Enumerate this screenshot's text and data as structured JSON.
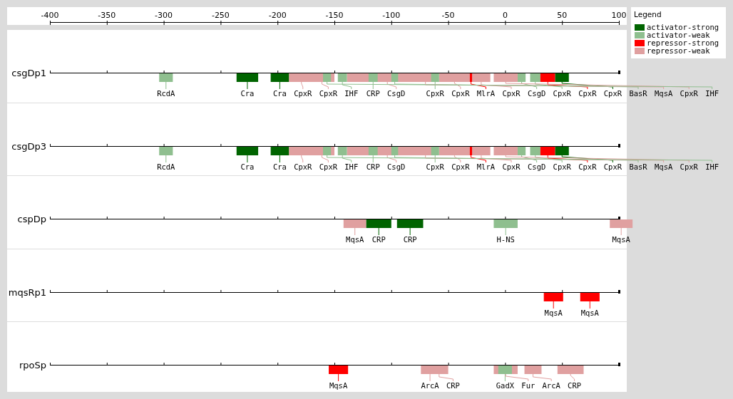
{
  "axis": {
    "ticks": [
      "-400",
      "-350",
      "-300",
      "-250",
      "-200",
      "-150",
      "-100",
      "-50",
      "0",
      "50",
      "100"
    ]
  },
  "tracks": [
    {
      "name": "csgDp1",
      "sites": [
        {
          "label": "RcdA",
          "kind": "activator-weak"
        },
        {
          "label": "Cra",
          "kind": "activator-strong"
        },
        {
          "label": "Cra",
          "kind": "activator-strong"
        },
        {
          "label": "CpxR",
          "kind": "repressor-weak"
        },
        {
          "label": "CpxR",
          "kind": "repressor-weak"
        },
        {
          "label": "IHF",
          "kind": "activator-weak"
        },
        {
          "label": "CRP",
          "kind": "activator-weak"
        },
        {
          "label": "CsgD",
          "kind": "repressor-weak"
        },
        {
          "label": "CpxR",
          "kind": "activator-weak"
        },
        {
          "label": "CpxR",
          "kind": "repressor-weak"
        },
        {
          "label": "MlrA",
          "kind": "repressor-strong"
        },
        {
          "label": "CpxR",
          "kind": "repressor-weak"
        },
        {
          "label": "CsgD",
          "kind": "activator-weak"
        },
        {
          "label": "CpxR",
          "kind": "activator-weak"
        },
        {
          "label": "CpxR",
          "kind": "repressor-strong"
        },
        {
          "label": "CpxR",
          "kind": "activator-strong"
        },
        {
          "label": "BasR",
          "kind": "activator-weak"
        },
        {
          "label": "MqsA",
          "kind": "repressor-weak"
        },
        {
          "label": "CpxR",
          "kind": "repressor-weak"
        },
        {
          "label": "IHF",
          "kind": "activator-weak"
        }
      ]
    },
    {
      "name": "csgDp3",
      "sites": [
        {
          "label": "RcdA",
          "kind": "activator-weak"
        },
        {
          "label": "Cra",
          "kind": "activator-strong"
        },
        {
          "label": "Cra",
          "kind": "activator-strong"
        },
        {
          "label": "CpxR",
          "kind": "repressor-weak"
        },
        {
          "label": "CpxR",
          "kind": "repressor-weak"
        },
        {
          "label": "IHF",
          "kind": "activator-weak"
        },
        {
          "label": "CRP",
          "kind": "activator-weak"
        },
        {
          "label": "CsgD",
          "kind": "repressor-weak"
        },
        {
          "label": "CpxR",
          "kind": "activator-weak"
        },
        {
          "label": "CpxR",
          "kind": "repressor-weak"
        },
        {
          "label": "MlrA",
          "kind": "repressor-strong"
        },
        {
          "label": "CpxR",
          "kind": "repressor-weak"
        },
        {
          "label": "CsgD",
          "kind": "activator-weak"
        },
        {
          "label": "CpxR",
          "kind": "activator-weak"
        },
        {
          "label": "CpxR",
          "kind": "repressor-strong"
        },
        {
          "label": "CpxR",
          "kind": "activator-strong"
        },
        {
          "label": "BasR",
          "kind": "activator-weak"
        },
        {
          "label": "MqsA",
          "kind": "repressor-weak"
        },
        {
          "label": "CpxR",
          "kind": "repressor-weak"
        },
        {
          "label": "IHF",
          "kind": "activator-weak"
        }
      ]
    },
    {
      "name": "cspDp",
      "sites": [
        {
          "label": "MqsA",
          "kind": "repressor-weak"
        },
        {
          "label": "CRP",
          "kind": "activator-strong"
        },
        {
          "label": "CRP",
          "kind": "activator-strong"
        },
        {
          "label": "H-NS",
          "kind": "activator-weak"
        },
        {
          "label": "MqsA",
          "kind": "repressor-weak"
        }
      ]
    },
    {
      "name": "mqsRp1",
      "sites": [
        {
          "label": "MqsA",
          "kind": "repressor-strong"
        },
        {
          "label": "MqsA",
          "kind": "repressor-strong"
        }
      ]
    },
    {
      "name": "rpoSp",
      "sites": [
        {
          "label": "MqsA",
          "kind": "repressor-strong"
        },
        {
          "label": "ArcA",
          "kind": "repressor-weak"
        },
        {
          "label": "CRP",
          "kind": "repressor-weak"
        },
        {
          "label": "GadX",
          "kind": "activator-weak"
        },
        {
          "label": "Fur",
          "kind": "repressor-weak"
        },
        {
          "label": "ArcA",
          "kind": "repressor-weak"
        },
        {
          "label": "CRP",
          "kind": "repressor-weak"
        }
      ]
    }
  ],
  "legend": {
    "title": "Legend",
    "items": [
      {
        "label": "activator-strong",
        "color": "#006400"
      },
      {
        "label": "activator-weak",
        "color": "#8fbf8f"
      },
      {
        "label": "repressor-strong",
        "color": "#ff0000"
      },
      {
        "label": "repressor-weak",
        "color": "#e0a0a0"
      }
    ]
  }
}
